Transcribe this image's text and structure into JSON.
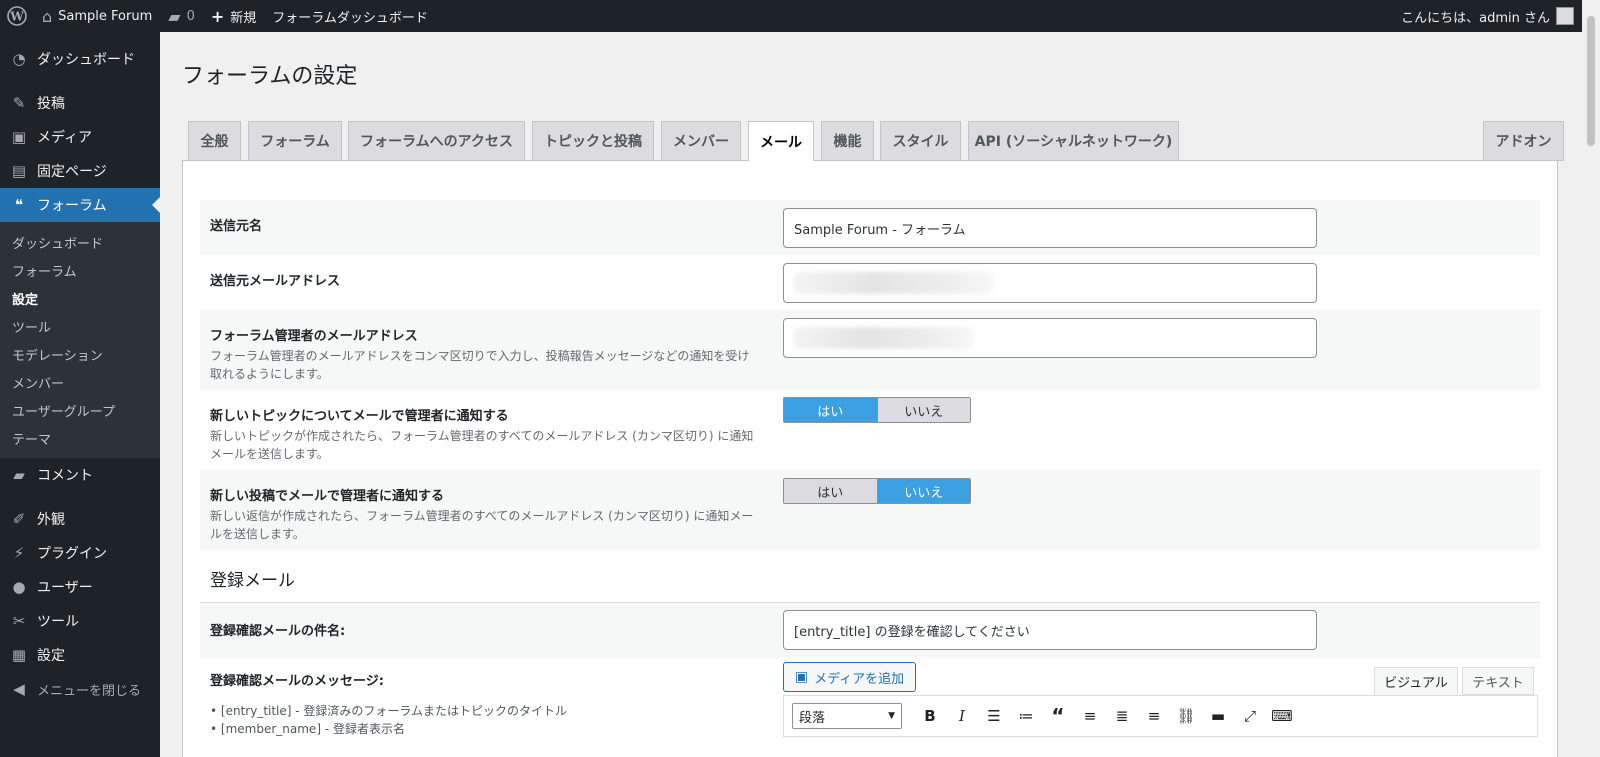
{
  "admin_bar": {
    "site_name": "Sample Forum",
    "comments_count": "0",
    "new_label": "新規",
    "dashboard_link": "フォーラムダッシュボード",
    "greeting": "こんにちは、admin さん"
  },
  "sidebar": {
    "items": [
      {
        "label": "ダッシュボード",
        "icon": "dashboard-icon"
      },
      {
        "label": "投稿",
        "icon": "pin-icon"
      },
      {
        "label": "メディア",
        "icon": "media-icon"
      },
      {
        "label": "固定ページ",
        "icon": "page-icon"
      },
      {
        "label": "フォーラム",
        "icon": "forum-icon"
      },
      {
        "label": "コメント",
        "icon": "comment-icon"
      },
      {
        "label": "外観",
        "icon": "brush-icon"
      },
      {
        "label": "プラグイン",
        "icon": "plugin-icon"
      },
      {
        "label": "ユーザー",
        "icon": "user-icon"
      },
      {
        "label": "ツール",
        "icon": "wrench-icon"
      },
      {
        "label": "設定",
        "icon": "settings-icon"
      },
      {
        "label": "メニューを閉じる",
        "icon": "collapse-icon"
      }
    ],
    "forum_submenu": [
      "ダッシュボード",
      "フォーラム",
      "設定",
      "ツール",
      "モデレーション",
      "メンバー",
      "ユーザーグループ",
      "テーマ"
    ]
  },
  "page": {
    "title": "フォーラムの設定",
    "tabs": [
      "全般",
      "フォーラム",
      "フォーラムへのアクセス",
      "トピックと投稿",
      "メンバー",
      "メール",
      "機能",
      "スタイル",
      "API (ソーシャルネットワーク)"
    ],
    "active_tab": "メール",
    "addon_tab": "アドオン"
  },
  "settings": {
    "sender_name": {
      "label": "送信元名",
      "value": "Sample Forum - フォーラム"
    },
    "sender_email": {
      "label": "送信元メールアドレス"
    },
    "admin_email": {
      "label": "フォーラム管理者のメールアドレス",
      "desc": "フォーラム管理者のメールアドレスをコンマ区切りで入力し、投稿報告メッセージなどの通知を受け取れるようにします。"
    },
    "notify_topic": {
      "label": "新しいトピックについてメールで管理者に通知する",
      "desc": "新しいトピックが作成されたら、フォーラム管理者のすべてのメールアドレス (カンマ区切り) に通知メールを送信します。",
      "yes": "はい",
      "no": "いいえ",
      "selected": "はい"
    },
    "notify_post": {
      "label": "新しい投稿でメールで管理者に通知する",
      "desc": "新しい返信が作成されたら、フォーラム管理者のすべてのメールアドレス (カンマ区切り) に通知メールを送信します。",
      "yes": "はい",
      "no": "いいえ",
      "selected": "いいえ"
    },
    "registration_section": "登録メール",
    "confirm_subject": {
      "label": "登録確認メールの件名:",
      "value": "[entry_title] の登録を確認してください"
    },
    "confirm_message": {
      "label": "登録確認メールのメッセージ:",
      "tags": [
        "[entry_title] - 登録済みのフォーラムまたはトピックのタイトル",
        "[member_name] - 登録者表示名"
      ]
    },
    "editor": {
      "add_media": "メディアを追加",
      "visual_tab": "ビジュアル",
      "text_tab": "テキスト",
      "format_select": "段落"
    }
  }
}
